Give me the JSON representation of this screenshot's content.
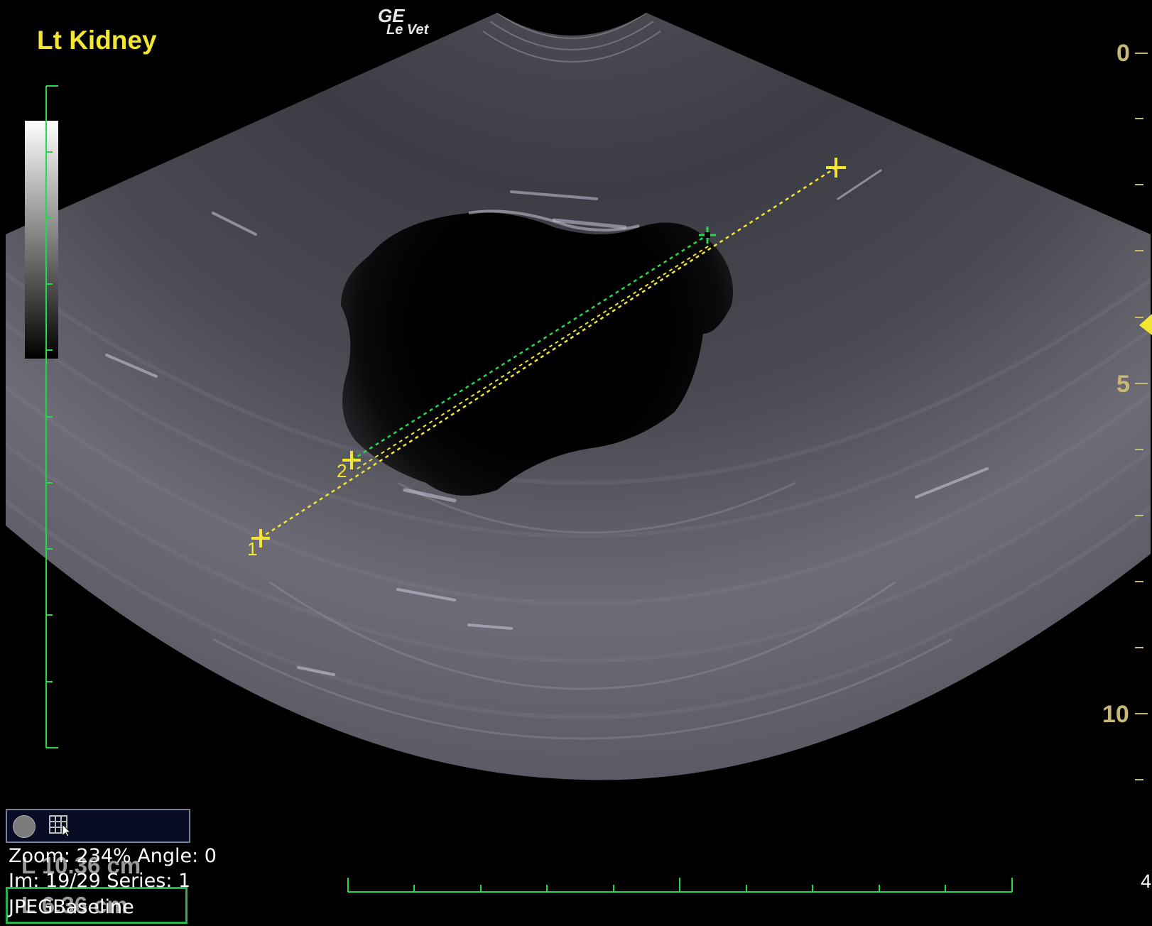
{
  "study": {
    "organ_label": "Lt Kidney",
    "brand_line1": "GE",
    "brand_line2": "Le Vet"
  },
  "depth_scale": {
    "labels": [
      "0",
      "5",
      "10"
    ],
    "unit_tick_label": "4"
  },
  "calipers": {
    "point_1": "1",
    "point_2": "2"
  },
  "measurements": {
    "line1_value": "L  10.36 cm",
    "line2_value": "L   6.36 cm"
  },
  "info": {
    "zoom_text": "Zoom: 234% Angle: 0",
    "image_text": "Im: 19/29  Series:  1",
    "compression_text": "JPEGBaseline"
  },
  "colors": {
    "label": "#f2e633",
    "caliper": "#f2e633",
    "caliper_active": "#27d84a",
    "scale_green": "#27d84a",
    "depth_text": "#c8b878"
  },
  "icons": {
    "circle_button": "record-circle-icon",
    "grid_button": "grid-cursor-icon"
  }
}
